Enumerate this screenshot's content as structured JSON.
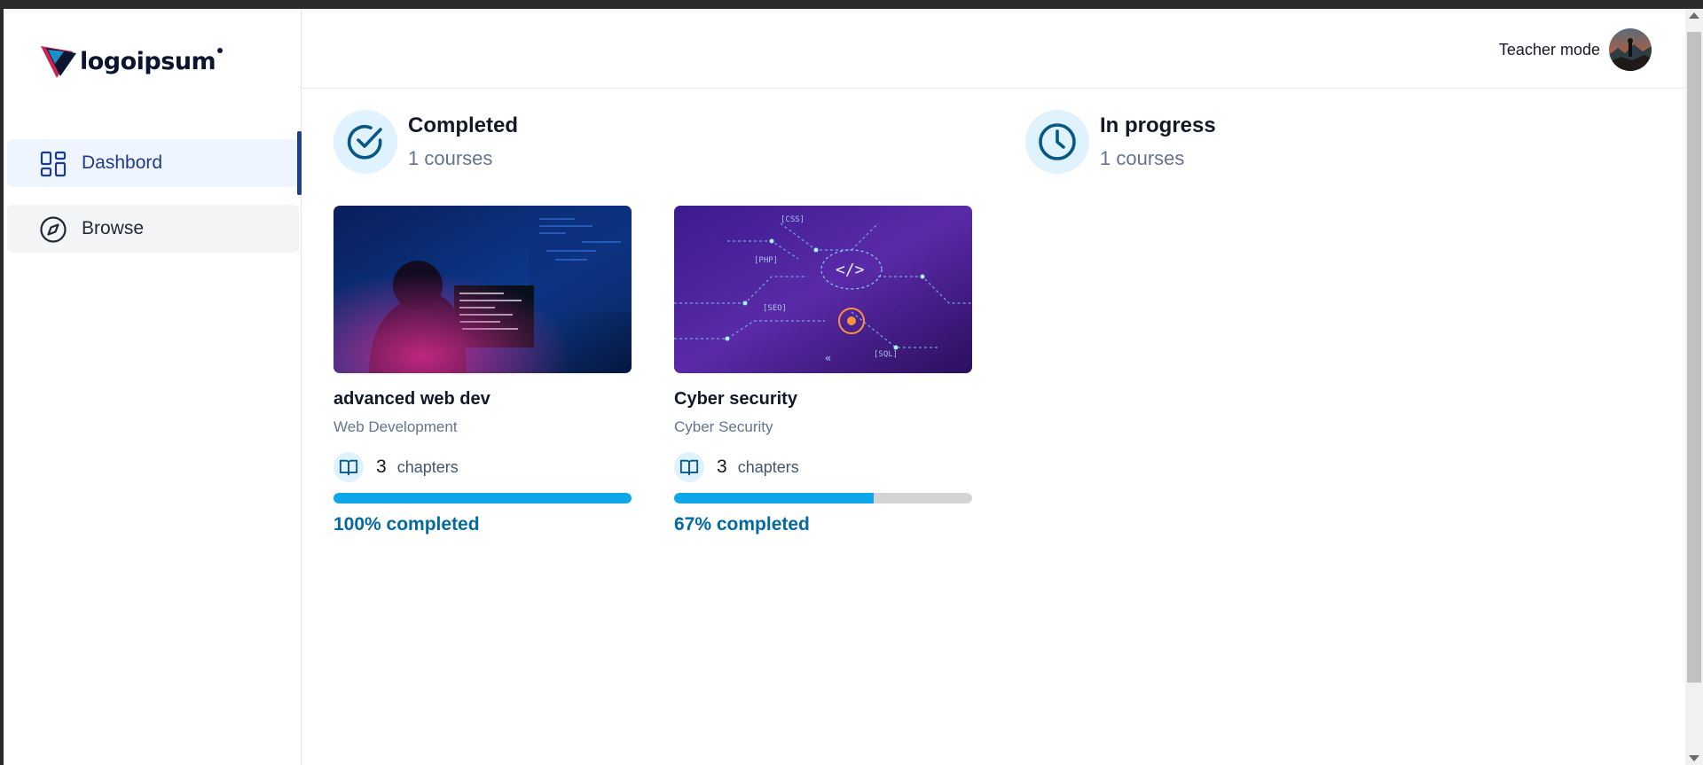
{
  "brand": {
    "name": "logoipsum"
  },
  "sidebar": {
    "items": [
      {
        "label": "Dashbord",
        "icon": "layout-dashboard-icon",
        "active": true
      },
      {
        "label": "Browse",
        "icon": "compass-icon",
        "active": false
      }
    ]
  },
  "header": {
    "teacher_mode_label": "Teacher mode"
  },
  "summary": {
    "completed": {
      "title": "Completed",
      "count": "1 courses",
      "icon": "check-circle-icon"
    },
    "in_progress": {
      "title": "In progress",
      "count": "1 courses",
      "icon": "clock-icon"
    }
  },
  "courses": [
    {
      "title": "advanced web dev",
      "category": "Web Development",
      "chapters": "3",
      "chapters_label": "chapters",
      "progress": 100,
      "progress_label": "100% completed"
    },
    {
      "title": "Cyber security",
      "category": "Cyber Security",
      "chapters": "3",
      "chapters_label": "chapters",
      "progress": 67,
      "progress_label": "67% completed"
    }
  ],
  "colors": {
    "accent": "#0ea5e9",
    "progress_text": "#0369a1",
    "active_nav_bg": "#eef5fe",
    "active_nav_text": "#1e3a8a"
  }
}
